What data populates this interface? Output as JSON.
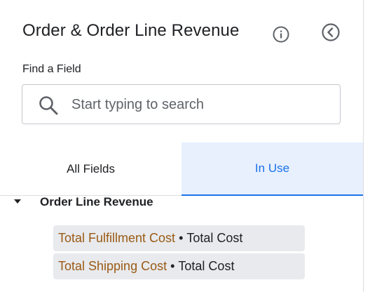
{
  "header": {
    "title": "Order & Order Line Revenue",
    "info_icon": "info-icon",
    "back_icon": "chevron-left-circle-icon"
  },
  "search": {
    "label": "Find a Field",
    "placeholder": "Start typing to search",
    "value": "",
    "icon": "search-icon"
  },
  "tabs": [
    {
      "label": "All Fields",
      "selected": false
    },
    {
      "label": "In Use",
      "selected": true
    }
  ],
  "group": {
    "label": "Order Line Revenue",
    "expanded": true,
    "items": [
      {
        "field": "Total Fulfillment Cost",
        "separator": "•",
        "metric": "Total Cost"
      },
      {
        "field": "Total Shipping Cost",
        "separator": "•",
        "metric": "Total Cost"
      }
    ]
  },
  "colors": {
    "accent": "#1a73e8",
    "selected_tab_bg": "#e8f0fe",
    "field_text": "#9a5a16",
    "chip_bg": "#e8eaed"
  }
}
